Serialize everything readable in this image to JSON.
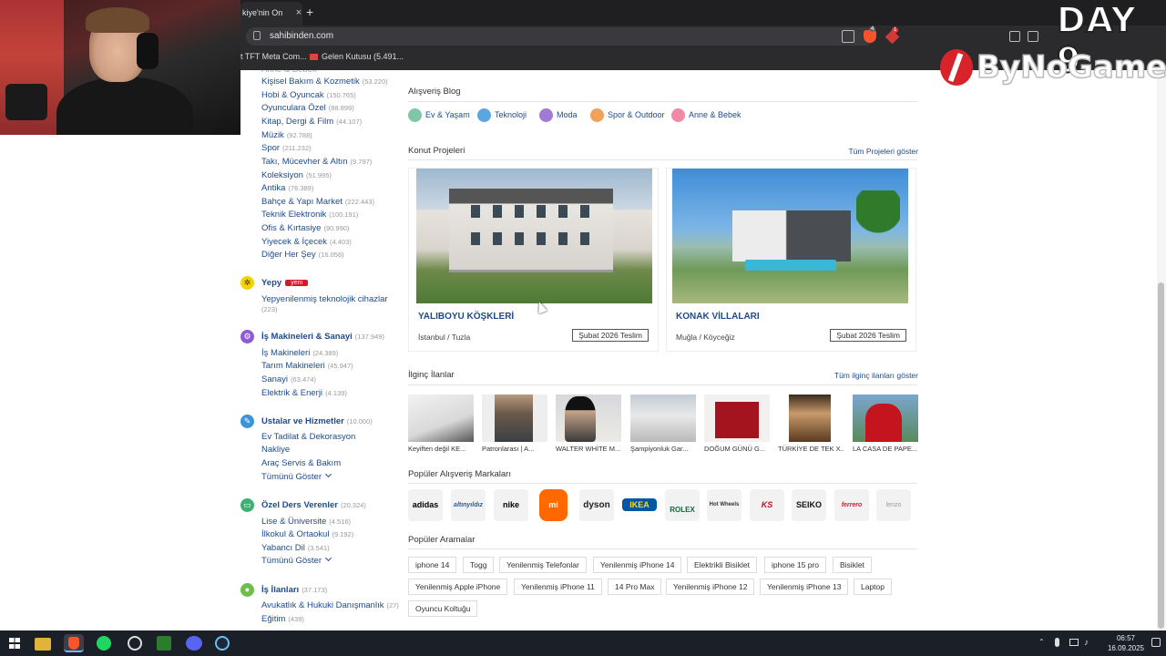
{
  "browser": {
    "tab_title": "kiye'nin On",
    "tab_close": "×",
    "new_tab": "+",
    "url": "sahibinden.com",
    "brave_badge": "4",
    "rewards_badge": "1",
    "bookmarks": [
      {
        "label": "t TFT Meta Com..."
      },
      {
        "label": "Gelen Kutusu (5.491..."
      }
    ]
  },
  "overlay": {
    "day": "DAY 9",
    "logo_text": "ByNoGame"
  },
  "sidebar": {
    "top_links": [
      {
        "label": "Kişisel Bakım & Kozmetik",
        "count": "(53.220)"
      },
      {
        "label": "Hobi & Oyuncak",
        "count": "(150.765)"
      },
      {
        "label": "Oyunculara Özel",
        "count": "(88.899)"
      },
      {
        "label": "Kitap, Dergi & Film",
        "count": "(44.107)"
      },
      {
        "label": "Müzik",
        "count": "(92.788)"
      },
      {
        "label": "Spor",
        "count": "(211.232)"
      },
      {
        "label": "Takı, Mücevher & Altın",
        "count": "(9.797)"
      },
      {
        "label": "Koleksiyon",
        "count": "(51.995)"
      },
      {
        "label": "Antika",
        "count": "(76.389)"
      },
      {
        "label": "Bahçe & Yapı Market",
        "count": "(222.443)"
      },
      {
        "label": "Teknik Elektronik",
        "count": "(100.191)"
      },
      {
        "label": "Ofis & Kırtasiye",
        "count": "(90.990)"
      },
      {
        "label": "Yiyecek & İçecek",
        "count": "(4.403)"
      },
      {
        "label": "Diğer Her Şey",
        "count": "(16.056)"
      }
    ],
    "yepy": {
      "title": "Yepy",
      "badge": "yeni",
      "link": "Yepyenilenmiş teknolojik cihazlar",
      "count": "(223)"
    },
    "is_makineleri": {
      "title": "İş Makineleri & Sanayi",
      "count": "(137.949)",
      "links": [
        {
          "label": "İş Makineleri",
          "count": "(24.389)"
        },
        {
          "label": "Tarım Makineleri",
          "count": "(45.947)"
        },
        {
          "label": "Sanayi",
          "count": "(63.474)"
        },
        {
          "label": "Elektrik & Enerji",
          "count": "(4.139)"
        }
      ]
    },
    "ustalar": {
      "title": "Ustalar ve Hizmetler",
      "count": "(10.000)",
      "links": [
        {
          "label": "Ev Tadilat & Dekorasyon"
        },
        {
          "label": "Nakliye"
        },
        {
          "label": "Araç Servis & Bakım"
        }
      ],
      "more": "Tümünü Göster"
    },
    "ozel_ders": {
      "title": "Özel Ders Verenler",
      "count": "(20.324)",
      "links": [
        {
          "label": "Lise & Üniversite",
          "count": "(4.516)"
        },
        {
          "label": "İlkokul & Ortaokul",
          "count": "(9.192)"
        },
        {
          "label": "Yabancı Dil",
          "count": "(3.541)"
        }
      ],
      "more": "Tümünü Göster"
    },
    "is_ilanlari": {
      "title": "İş İlanları",
      "count": "(37.173)",
      "links": [
        {
          "label": "Avukatlık & Hukuki Danışmanlık",
          "count": "(27)"
        },
        {
          "label": "Eğitim",
          "count": "(439)"
        }
      ]
    }
  },
  "main": {
    "blog": {
      "title": "Alışveriş Blog",
      "items": [
        {
          "label": "Ev & Yaşam",
          "color": "#7fc7a8"
        },
        {
          "label": "Teknoloji",
          "color": "#5aa6e0"
        },
        {
          "label": "Moda",
          "color": "#a27ad6"
        },
        {
          "label": "Spor & Outdoor",
          "color": "#f0a15a"
        },
        {
          "label": "Anne & Bebek",
          "color": "#f08aa5"
        }
      ]
    },
    "projects": {
      "title": "Konut Projeleri",
      "link": "Tüm Projeleri göster",
      "items": [
        {
          "name": "YALIBOYU KÖŞKLERİ",
          "location": "İstanbul / Tuzla",
          "badge": "Şubat 2026 Teslim"
        },
        {
          "name": "KONAK VİLLALARI",
          "location": "Muğla / Köyceğiz",
          "badge": "Şubat 2026 Teslim"
        }
      ]
    },
    "interesting": {
      "title": "İlginç İlanlar",
      "link": "Tüm ilginç ilanları göster",
      "items": [
        {
          "caption": "Keyiften değil KE..."
        },
        {
          "caption": "Patronlarası | A..."
        },
        {
          "caption": "WALTER WHİTE M..."
        },
        {
          "caption": "Şampiyonluk Gar..."
        },
        {
          "caption": "DOĞUM GÜNÜ G..."
        },
        {
          "caption": "TÜRKİYE DE TEK X..."
        },
        {
          "caption": "LA CASA DE PAPE..."
        }
      ]
    },
    "brands": {
      "title": "Popüler Alışveriş Markaları",
      "items": [
        {
          "label": "adidas",
          "color": "#000000"
        },
        {
          "label": "altınyıldız",
          "color": "#1c5fb0"
        },
        {
          "label": "nike",
          "color": "#000000"
        },
        {
          "label": "mi",
          "color": "#ff6900"
        },
        {
          "label": "dyson",
          "color": "#222222"
        },
        {
          "label": "IKEA",
          "color": "#0058a3"
        },
        {
          "label": "ROLEX",
          "color": "#0a6b3c"
        },
        {
          "label": "Hot Wheels",
          "color": "#333333"
        },
        {
          "label": "KS",
          "color": "#c0102a"
        },
        {
          "label": "SEIKO",
          "color": "#111111"
        },
        {
          "label": "ferrero",
          "color": "#d41f2b"
        },
        {
          "label": "lenzo",
          "color": "#999999"
        }
      ]
    },
    "searches": {
      "title": "Popüler Aramalar",
      "rows": [
        [
          "iphone 14",
          "Togg",
          "Yenilenmiş Telefonlar",
          "Yenilenmiş iPhone 14",
          "Elektrikli Bisiklet",
          "iphone 15 pro",
          "Bisiklet"
        ],
        [
          "Yenilenmiş Apple iPhone",
          "Yenilenmiş iPhone 11",
          "14 Pro Max",
          "Yenilenmiş iPhone 12",
          "Yenilenmiş iPhone 13",
          "Laptop"
        ],
        [
          "Oyuncu Koltuğu"
        ]
      ]
    }
  },
  "taskbar": {
    "time": "06:57",
    "date": "16.09.2025"
  }
}
